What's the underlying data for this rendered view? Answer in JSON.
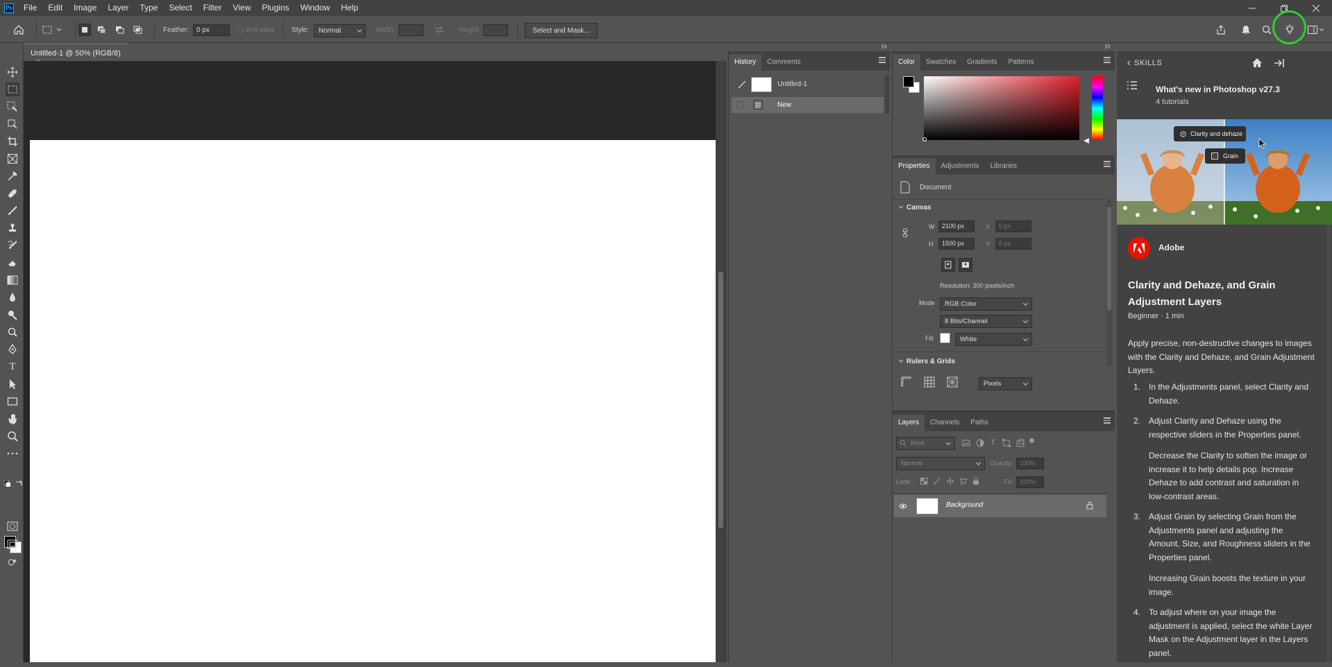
{
  "app": {
    "logo": "Ps"
  },
  "menu": [
    "File",
    "Edit",
    "Image",
    "Layer",
    "Type",
    "Select",
    "Filter",
    "View",
    "Plugins",
    "Window",
    "Help"
  ],
  "options": {
    "feather_label": "Feather:",
    "feather_value": "0 px",
    "antialias_label": "Anti-alias",
    "style_label": "Style:",
    "style_value": "Normal",
    "width_label": "Width:",
    "height_label": "Height:",
    "select_mask": "Select and Mask..."
  },
  "document": {
    "tab_title": "Untitled-1 @ 50% (RGB/8)",
    "close": "×"
  },
  "history": {
    "tabs": [
      "History",
      "Comments"
    ],
    "snapshot": "Untitled-1",
    "items": [
      "New"
    ]
  },
  "color_panel": {
    "tabs": [
      "Color",
      "Swatches",
      "Gradients",
      "Patterns"
    ]
  },
  "properties": {
    "tabs": [
      "Properties",
      "Adjustments",
      "Libraries"
    ],
    "doc_label": "Document",
    "canvas_title": "Canvas",
    "w_label": "W",
    "w_value": "2100 px",
    "h_label": "H",
    "h_value": "1500 px",
    "x_label": "X",
    "x_value": "0 px",
    "y_label": "Y",
    "y_value": "0 px",
    "resolution": "Resolution: 300 pixels/inch",
    "mode_label": "Mode",
    "mode_value": "RGB Color",
    "bits_value": "8 Bits/Channel",
    "fill_label": "Fill",
    "fill_value": "White",
    "rulers_title": "Rulers & Grids",
    "units_value": "Pixels"
  },
  "layers": {
    "tabs": [
      "Layers",
      "Channels",
      "Paths"
    ],
    "kind": "Kind",
    "blend": "Normal",
    "opacity_label": "Opacity:",
    "opacity_value": "100%",
    "lock_label": "Lock:",
    "fill_label": "Fill:",
    "fill_value": "100%",
    "layer_name": "Background"
  },
  "learn": {
    "back_label": "SKILLS",
    "header_title": "What's new in Photoshop v27.3",
    "header_sub": "4 tutorials",
    "tip1": "Clarity and dehaze",
    "tip2": "Grain",
    "author": "Adobe",
    "title": "Clarity and Dehaze, and Grain Adjustment Layers",
    "meta": "Beginner · 1 min",
    "intro": "Apply precise, non-destructive changes to images with the Clarity and Dehaze, and Grain Adjustment Layers.",
    "steps": [
      {
        "num": "1.",
        "text": "In the Adjustments panel, select Clarity and Dehaze.",
        "sub": ""
      },
      {
        "num": "2.",
        "text": "Adjust Clarity and Dehaze using the respective sliders in the Properties panel.",
        "sub": "Decrease the Clarity to soften the image or increase it to help details pop. Increase Dehaze to add contrast and saturation in low-contrast areas."
      },
      {
        "num": "3.",
        "text": "Adjust Grain by selecting Grain from the Adjustments panel and adjusting the Amount, Size, and Roughness sliders in the Properties panel.",
        "sub": "Increasing Grain boosts the texture in your image."
      },
      {
        "num": "4.",
        "text": "To adjust where on your image the adjustment is applied, select the white Layer Mask on the Adjustment layer in the Layers panel.",
        "sub": ""
      }
    ]
  },
  "colors": {
    "accent_highlight": "#2bd12b",
    "adobe_red": "#eb1000"
  }
}
